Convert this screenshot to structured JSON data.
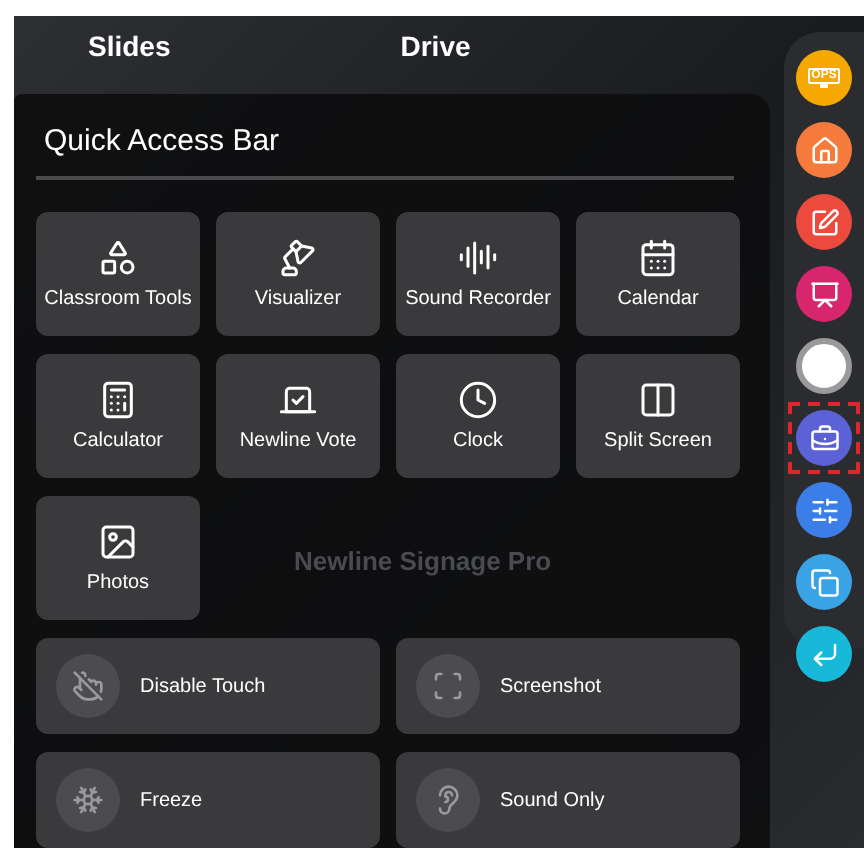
{
  "top_tabs": [
    {
      "label": "Slides"
    },
    {
      "label": "Drive"
    }
  ],
  "background_apps": [
    {
      "label": "Newline Signage Pro"
    }
  ],
  "quick_access": {
    "title": "Quick Access Bar",
    "apps": [
      {
        "label": "Classroom Tools"
      },
      {
        "label": "Visualizer"
      },
      {
        "label": "Sound Recorder"
      },
      {
        "label": "Calendar"
      },
      {
        "label": "Calculator"
      },
      {
        "label": "Newline Vote"
      },
      {
        "label": "Clock"
      },
      {
        "label": "Split Screen"
      },
      {
        "label": "Photos"
      }
    ],
    "toggles": [
      {
        "label": "Disable Touch"
      },
      {
        "label": "Screenshot"
      },
      {
        "label": "Freeze"
      },
      {
        "label": "Sound Only"
      }
    ]
  },
  "sidebar": [
    {
      "kind": "icon",
      "color": "#f5a800",
      "selected": false,
      "label": "OPS"
    },
    {
      "kind": "icon",
      "color": "#f47b3c",
      "selected": false
    },
    {
      "kind": "icon",
      "color": "#ec4a3c",
      "selected": false
    },
    {
      "kind": "icon",
      "color": "#d7266d",
      "selected": false
    },
    {
      "kind": "ring",
      "color": "#ffffff",
      "selected": false
    },
    {
      "kind": "icon",
      "color": "#5b62d6",
      "selected": true
    },
    {
      "kind": "icon",
      "color": "#3b7ee8",
      "selected": false
    },
    {
      "kind": "icon",
      "color": "#3aa3e6",
      "selected": false
    },
    {
      "kind": "icon",
      "color": "#17b8d8",
      "selected": false
    }
  ]
}
